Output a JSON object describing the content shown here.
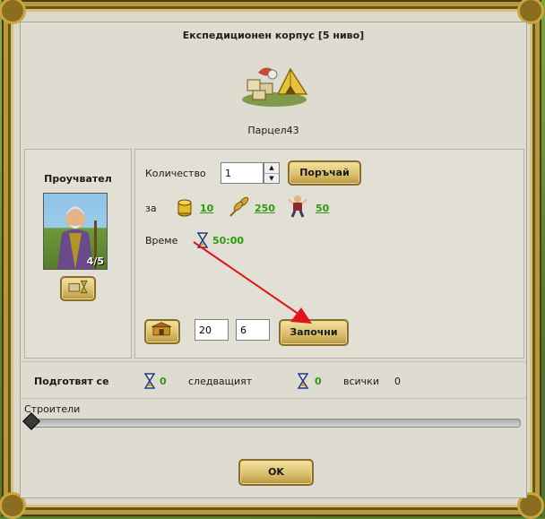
{
  "dialog": {
    "title": "Експедиционен корпус [5 ниво]",
    "parcel": "Парцел43"
  },
  "explorer": {
    "label": "Проучвател",
    "count": "4/5"
  },
  "order": {
    "quantity_label": "Количество",
    "quantity_value": "1",
    "order_button": "Поръчай",
    "for_label": "за",
    "costs": [
      {
        "icon": "gold-coins-icon",
        "value": "10"
      },
      {
        "icon": "wheat-icon",
        "value": "250"
      },
      {
        "icon": "settler-icon",
        "value": "50"
      }
    ],
    "time_label": "Време",
    "time_value": "50:00"
  },
  "batch": {
    "field_a": "20",
    "field_b": "6",
    "start_button": "Започни"
  },
  "queue": {
    "preparing_label": "Подготвят се",
    "preparing_value": "0",
    "next_label": "следващият",
    "next_value": "0",
    "all_label": "всички",
    "all_value": "0"
  },
  "builders": {
    "label": "Строители",
    "level": 0
  },
  "ok_button": "OK",
  "colors": {
    "frame_gold": "#b59a3c",
    "panel_bg": "#dedbd0",
    "value_green": "#2e9a10",
    "arrow_red": "#e0141e"
  }
}
